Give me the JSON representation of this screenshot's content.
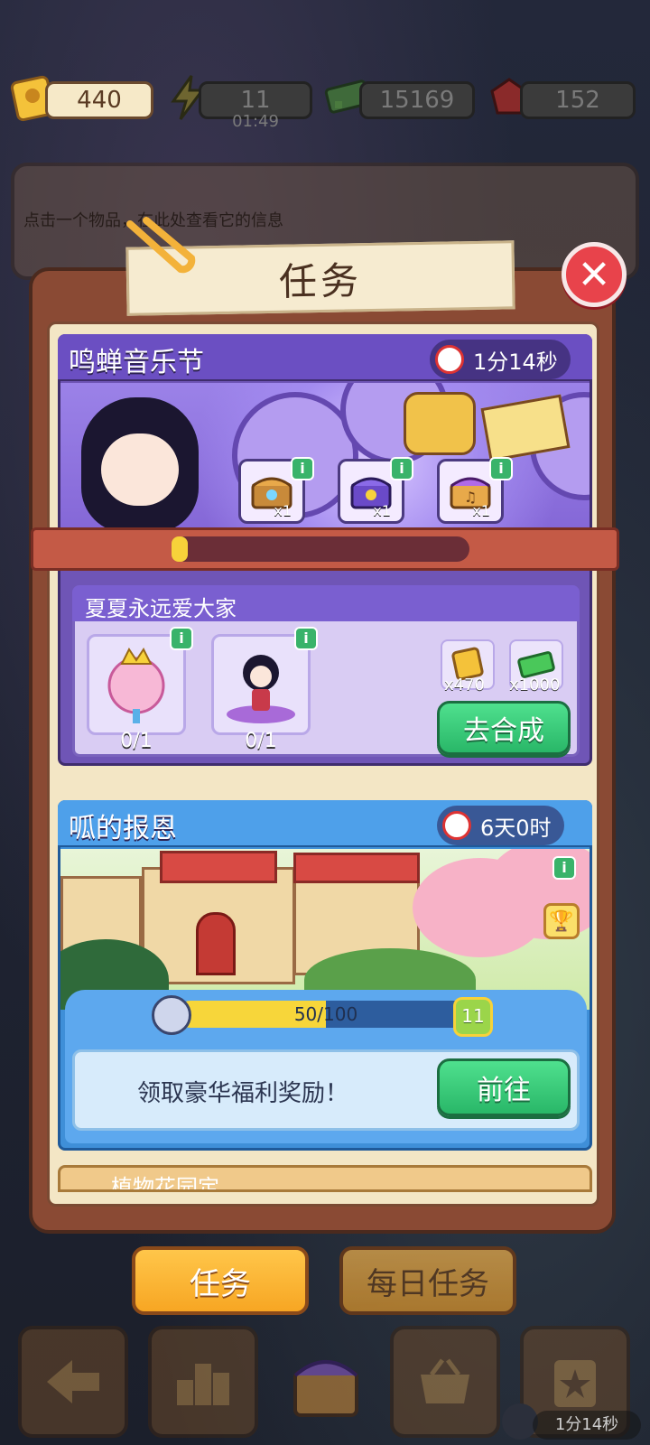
{
  "resources": {
    "tickets": "440",
    "energy": "11",
    "energy_timer": "01:49",
    "cash": "15169",
    "gems": "152"
  },
  "info_hint": "点击一个物品，在此处查看它的信息",
  "panel": {
    "title": "任务"
  },
  "event1": {
    "title": "鸣蝉音乐节",
    "timer": "1分14秒",
    "chests": [
      "x1",
      "x1",
      "x1"
    ],
    "progress": 0.0,
    "subtask": {
      "title": "夏夏永远爱大家",
      "requirements": [
        {
          "name": "cheer-bouquet",
          "count": "0/1"
        },
        {
          "name": "singer-figure",
          "count": "0/1"
        }
      ],
      "rewards": [
        {
          "icon": "ticket-icon",
          "count": "x470"
        },
        {
          "icon": "cash-icon",
          "count": "x1000"
        }
      ],
      "button": "去合成"
    }
  },
  "event2": {
    "title": "呱的报恩",
    "timer": "6天0时",
    "progress_text": "50/100",
    "progress": 0.5,
    "level": "11",
    "reward_label": "领取豪华福利奖励！",
    "button": "前往"
  },
  "event3": {
    "title": "植物花园定"
  },
  "tabs": {
    "tasks": "任务",
    "daily": "每日任务"
  },
  "bottom": {
    "timer": "1分14秒"
  },
  "colors": {
    "close": "#e8434b",
    "event1_header": "#6b4fc2",
    "event2_header": "#4ea0ea",
    "green_button": "#29b768",
    "active_tab": "#f7a623"
  }
}
